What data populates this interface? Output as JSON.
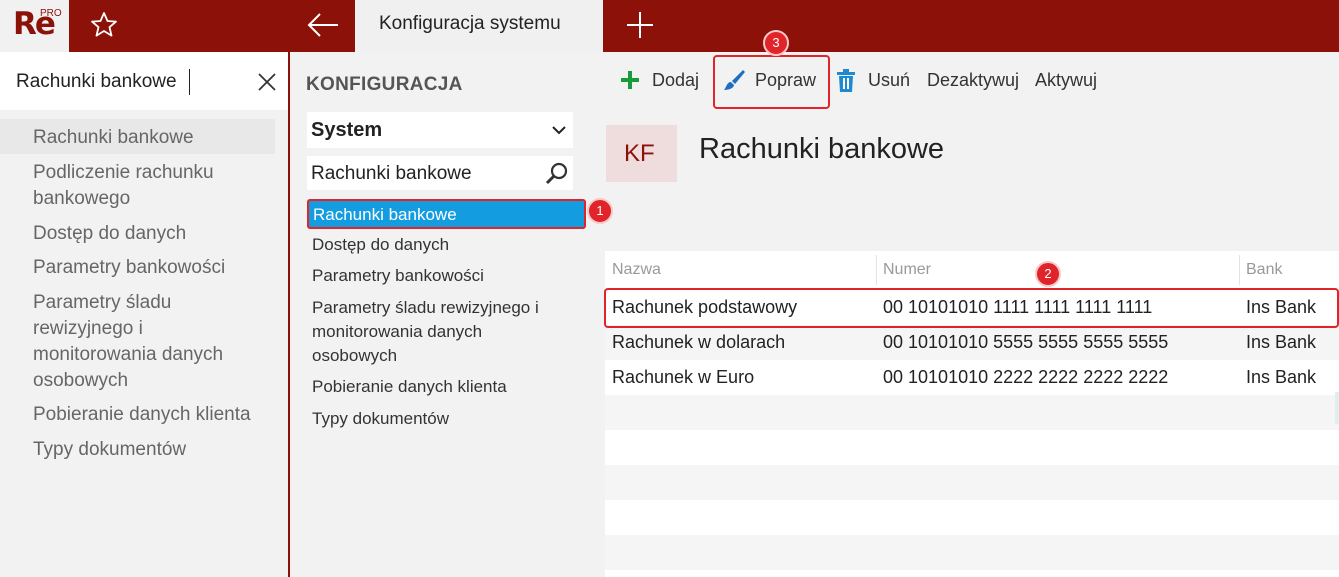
{
  "app": {
    "logo_text": "Re",
    "logo_badge": "PRO",
    "active_tab": "Konfiguracja systemu"
  },
  "search": {
    "value": "Rachunki bankowe"
  },
  "left_results": [
    "Rachunki bankowe",
    "Podliczenie rachunku bankowego",
    "Dostęp do danych",
    "Parametry bankowości",
    "Parametry śladu rewizyjnego i monitorowania danych osobowych",
    "Pobieranie danych klienta",
    "Typy dokumentów"
  ],
  "config": {
    "title": "KONFIGURACJA",
    "selected_group": "System",
    "filter_value": "Rachunki bankowe",
    "items": [
      "Rachunki bankowe",
      "Dostęp do danych",
      "Parametry bankowości",
      "Parametry śladu rewizyjnego i monitorowania danych osobowych",
      "Pobieranie danych klienta",
      "Typy dokumentów"
    ]
  },
  "toolbar": {
    "add": "Dodaj",
    "edit": "Popraw",
    "delete": "Usuń",
    "deactivate": "Dezaktywuj",
    "activate": "Aktywuj"
  },
  "content": {
    "badge": "KF",
    "title": "Rachunki bankowe"
  },
  "grid": {
    "columns": [
      "Nazwa",
      "Numer",
      "Bank"
    ],
    "rows": [
      [
        "Rachunek podstawowy",
        "00 10101010 1111 1111 1111 1111",
        "Ins Bank"
      ],
      [
        "Rachunek w dolarach",
        "00 10101010 5555 5555 5555 5555",
        "Ins Bank"
      ],
      [
        "Rachunek w Euro",
        "00 10101010 2222 2222 2222 2222",
        "Ins Bank"
      ]
    ]
  },
  "annotations": [
    "1",
    "2",
    "3"
  ],
  "colors": {
    "brand": "#8c1108",
    "selection": "#139de0",
    "highlight": "#e0242a",
    "add_icon": "#1a9b3a",
    "edit_icon": "#1e6fc1",
    "delete_icon": "#1e8ad0"
  }
}
